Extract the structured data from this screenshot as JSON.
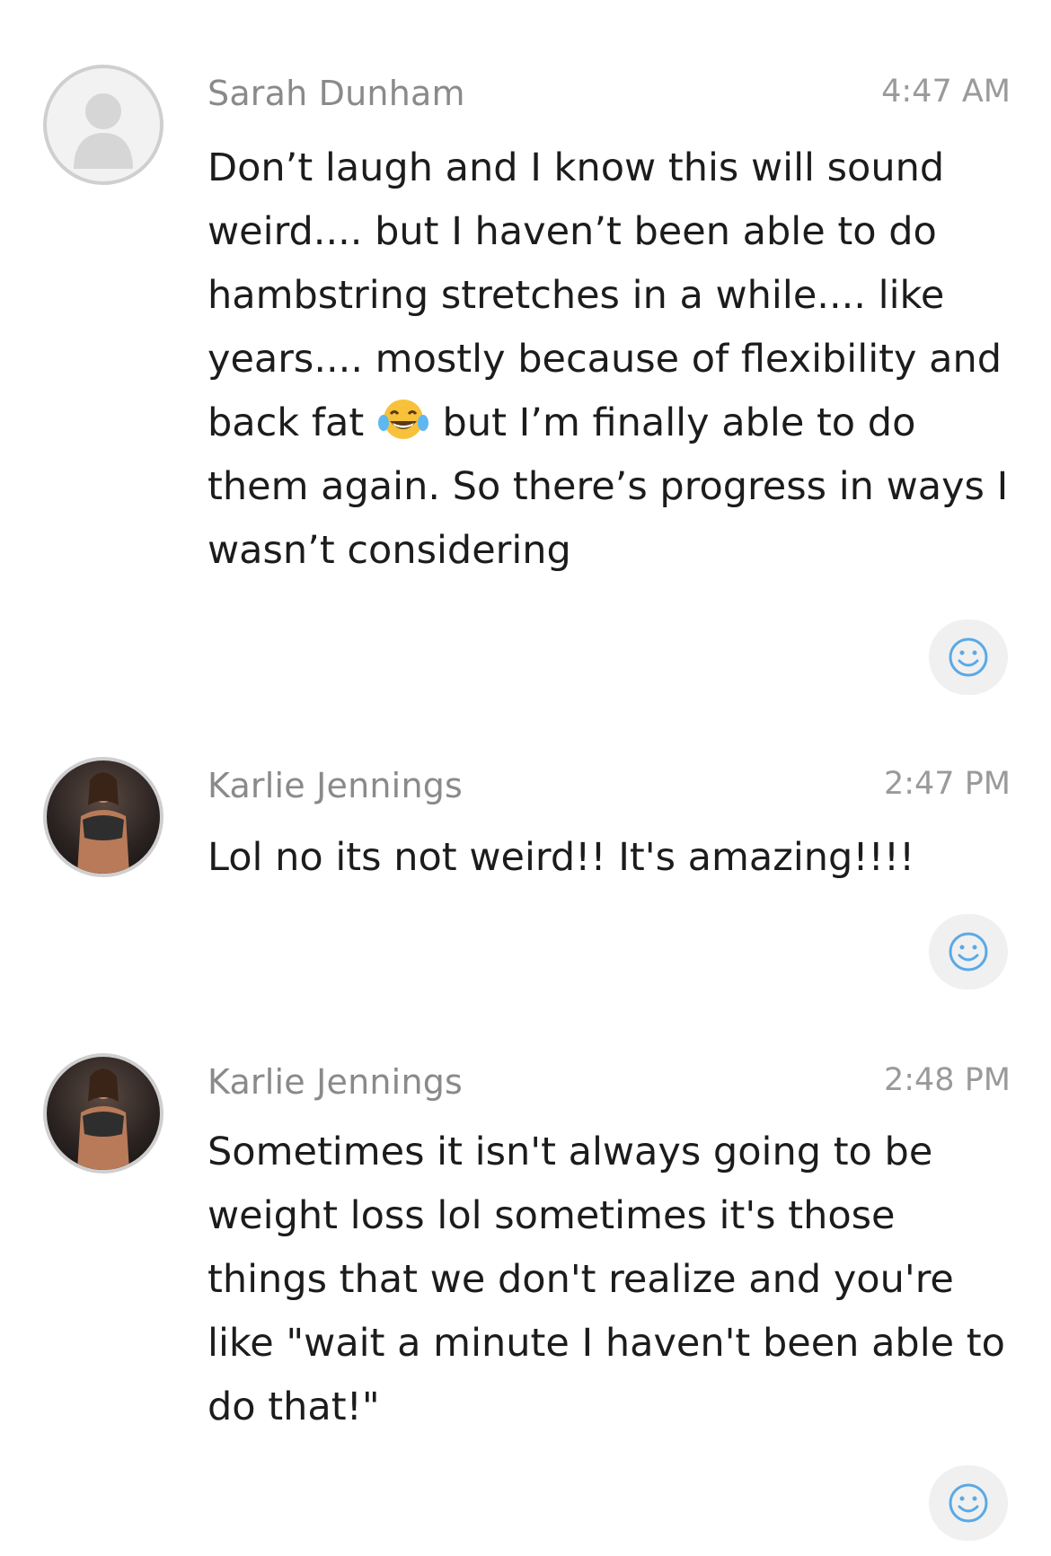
{
  "messages": [
    {
      "sender": "Sarah Dunham",
      "time": "4:47 AM",
      "avatar": "default-user-avatar",
      "text_before_emoji": "Don’t laugh and I know this will sound\nweird.... but I haven’t been able to do\nhambstring stretches in a while.... like\nyears.... mostly because of flexibility and\nback fat ",
      "inline_emoji": "tears-of-joy-emoji",
      "text_after_emoji": " but I’m finally able to do\nthem again. So there’s progress in ways I\nwasn’t considering"
    },
    {
      "sender": "Karlie Jennings",
      "time": "2:47 PM",
      "avatar": "photo-avatar",
      "text": "Lol no its not weird!! It's amazing!!!!"
    },
    {
      "sender": "Karlie Jennings",
      "time": "2:48 PM",
      "avatar": "photo-avatar",
      "text": "Sometimes it isn't always going to be\nweight loss lol sometimes it's those\nthings that we don't realize and you're\nlike \"wait a minute I haven't been able to\ndo that!\""
    }
  ],
  "colors": {
    "sender": "#8a8a8a",
    "time": "#9a9a9a",
    "text": "#1c1c1c",
    "react_icon": "#5aa9e6",
    "react_bg": "#f0f0f0"
  },
  "icons": {
    "react": "smiley-face-icon"
  }
}
